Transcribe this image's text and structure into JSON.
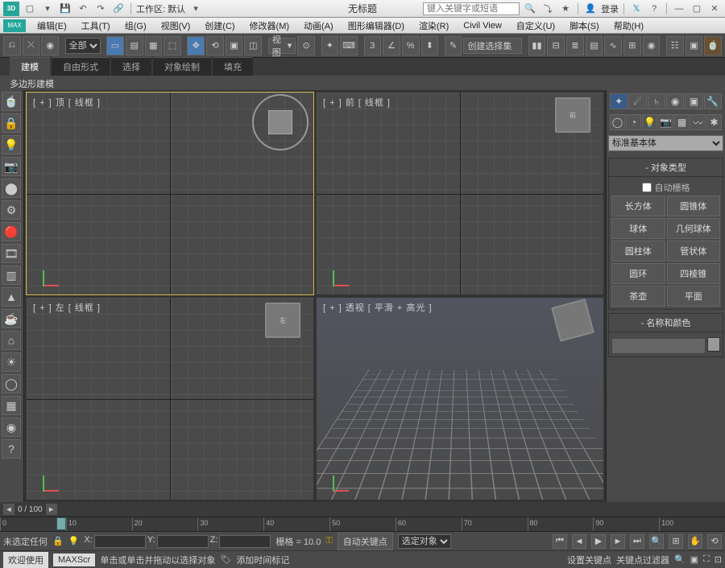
{
  "titlebar": {
    "workspace_label": "工作区: 默认",
    "title": "无标题",
    "search_placeholder": "键入关键字或短语",
    "login": "登录"
  },
  "menubar": {
    "logo": "MAX",
    "items": [
      "编辑(E)",
      "工具(T)",
      "组(G)",
      "视图(V)",
      "创建(C)",
      "修改器(M)",
      "动画(A)",
      "图形编辑器(D)",
      "渲染(R)",
      "Civil View",
      "自定义(U)",
      "脚本(S)",
      "帮助(H)"
    ]
  },
  "toolbar": {
    "all": "全部",
    "viewmode": "视图",
    "selset": "创建选择集"
  },
  "tabs": {
    "items": [
      "建模",
      "自由形式",
      "选择",
      "对象绘制",
      "填充"
    ],
    "active": 0
  },
  "subheader": "多边形建模",
  "viewports": {
    "top": "[ + ] 顶 [ 线框 ]",
    "front": "[ + ] 前 [ 线框 ]",
    "left": "[ + ] 左 [ 线框 ]",
    "persp": "[ + ] 透视 [ 平滑 + 高光 ]"
  },
  "rightpanel": {
    "dropdown": "标准基本体",
    "objtype_title": "对象类型",
    "autogrid": "自动栅格",
    "buttons": [
      [
        "长方体",
        "圆锥体"
      ],
      [
        "球体",
        "几何球体"
      ],
      [
        "圆柱体",
        "管状体"
      ],
      [
        "圆环",
        "四棱锥"
      ],
      [
        "茶壶",
        "平面"
      ]
    ],
    "namecolor_title": "名称和颜色"
  },
  "scroll": {
    "pos": "0 / 100"
  },
  "timeline": {
    "ticks": [
      "0",
      "10",
      "20",
      "30",
      "40",
      "50",
      "60",
      "70",
      "80",
      "90",
      "100"
    ]
  },
  "status": {
    "sel": "未选定任何",
    "x": "X:",
    "y": "Y:",
    "z": "Z:",
    "grid": "栅格 = 10.0",
    "autokey": "自动关键点",
    "selobj": "选定对象"
  },
  "bottom": {
    "welcome": "欢迎使用",
    "maxscr": "MAXScr",
    "hint": "单击或单击并拖动以选择对象",
    "addtime": "添加时间标记",
    "setkey": "设置关键点",
    "keyfilter": "关键点过滤器"
  }
}
